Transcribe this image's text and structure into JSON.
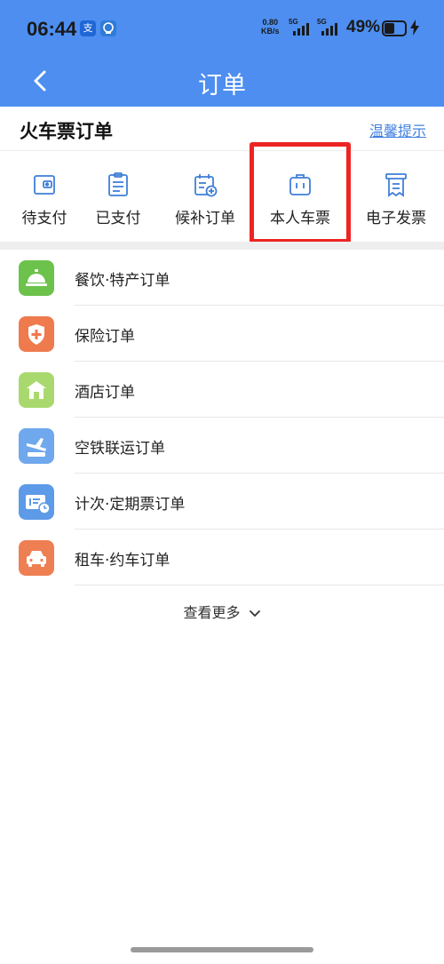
{
  "status_bar": {
    "time": "06:44",
    "badge_1_glyph": "支",
    "net_speed_value": "0.80",
    "net_speed_unit": "KB/s",
    "signal_1_label": "5G",
    "signal_2_label": "5G",
    "battery_percent": "49%",
    "battery_level": 0.49
  },
  "nav": {
    "title": "订单"
  },
  "section": {
    "title": "火车票订单",
    "tip_link": "温馨提示"
  },
  "tabs": [
    {
      "label": "待支付",
      "icon": "wallet-icon"
    },
    {
      "label": "已支付",
      "icon": "clipboard-icon"
    },
    {
      "label": "候补订单",
      "icon": "calendar-add-icon"
    },
    {
      "label": "本人车票",
      "icon": "luggage-icon"
    },
    {
      "label": "电子发票",
      "icon": "receipt-icon"
    }
  ],
  "orders": [
    {
      "label": "餐饮·特产订单",
      "icon": "food-bell-icon",
      "color": "#6cc24a"
    },
    {
      "label": "保险订单",
      "icon": "shield-plus-icon",
      "color": "#ee7a4e"
    },
    {
      "label": "酒店订单",
      "icon": "hotel-icon",
      "color": "#a9d96e"
    },
    {
      "label": "空铁联运订单",
      "icon": "plane-train-icon",
      "color": "#6fa8ec"
    },
    {
      "label": "计次·定期票订单",
      "icon": "ticket-clock-icon",
      "color": "#5d9ae8"
    },
    {
      "label": "租车·约车订单",
      "icon": "car-icon",
      "color": "#ee7f52"
    }
  ],
  "more_label": "查看更多",
  "colors": {
    "header_blue": "#4d8ef0",
    "link_blue": "#3f7fe0",
    "highlight_red": "#ee2424",
    "tab_icon_blue": "#3f7fd8"
  }
}
